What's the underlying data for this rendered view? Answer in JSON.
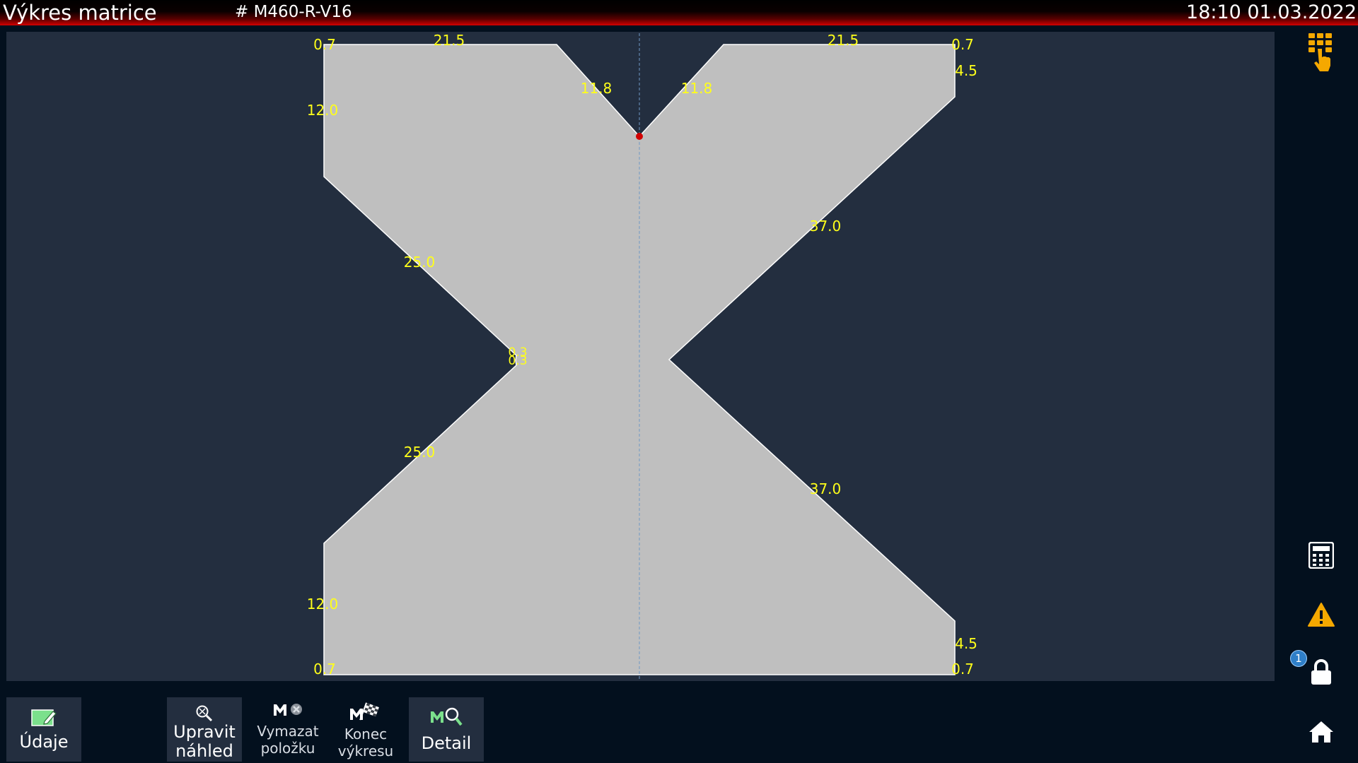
{
  "header": {
    "title": "Výkres matrice",
    "program": "# M460-R-V16",
    "datetime": "18:10 01.03.2022"
  },
  "drawing": {
    "fill_color": "#bfbfbf",
    "outline_color": "#ffffff",
    "dimension_color": "#ffff1a",
    "background": "#232e3f",
    "dimensions": {
      "top_left_corner": "0.7",
      "top_left_width": "21.5",
      "top_left_vee": "11.8",
      "top_right_vee": "11.8",
      "top_right_width": "21.5",
      "top_right_corner": "0.7",
      "right_upper_height": "4.5",
      "left_upper_height": "12.0",
      "left_upper_slant": "25.0",
      "right_upper_slant": "37.0",
      "left_notch_a": "0.3",
      "left_notch_b": "0.3",
      "left_lower_slant": "25.0",
      "right_lower_slant": "37.0",
      "left_lower_height": "12.0",
      "right_lower_height": "4.5",
      "bottom_left_corner": "0.7",
      "bottom_right_corner": "0.7"
    }
  },
  "sidebar": {
    "icons": [
      "keypad-touch-icon",
      "calculator-icon",
      "warning-icon",
      "lock-icon",
      "home-icon"
    ],
    "lock_badge": "1",
    "accent_color": "#f5a800"
  },
  "toolbar": {
    "udaje": "Údaje",
    "upravit_line1": "Upravit",
    "upravit_line2": "náhled",
    "vymazat_line1": "Vymazat",
    "vymazat_line2": "položku",
    "konec_line1": "Konec",
    "konec_line2": "výkresu",
    "detail": "Detail"
  }
}
